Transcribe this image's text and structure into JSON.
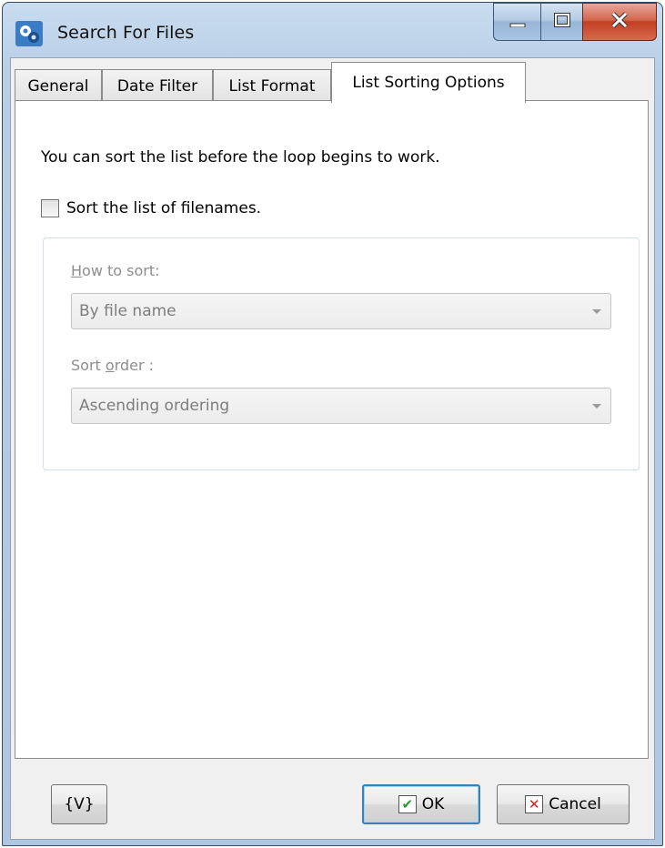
{
  "window": {
    "title": "Search For Files",
    "controls": {
      "minimize": "minimize",
      "maximize": "maximize",
      "close": "close"
    }
  },
  "tabs": [
    {
      "label": "General",
      "active": false
    },
    {
      "label": "Date Filter",
      "active": false
    },
    {
      "label": "List Format",
      "active": false
    },
    {
      "label": "List Sorting Options",
      "active": true
    }
  ],
  "page": {
    "intro": "You can sort the list before the loop begins to work.",
    "sort_checkbox": {
      "label": "Sort the list of filenames.",
      "checked": false
    },
    "how_to_sort": {
      "label_first": "H",
      "label_rest": "ow to sort:",
      "value": "By file name"
    },
    "sort_order": {
      "label_before": "Sort ",
      "label_underlined": "o",
      "label_after": "rder :",
      "value": "Ascending ordering"
    }
  },
  "footer": {
    "variables_label": "{V}",
    "ok_label": "OK",
    "cancel_label": "Cancel"
  },
  "icons": {
    "app": "gears-icon",
    "ok": "checkmark-icon",
    "cancel": "x-icon"
  }
}
